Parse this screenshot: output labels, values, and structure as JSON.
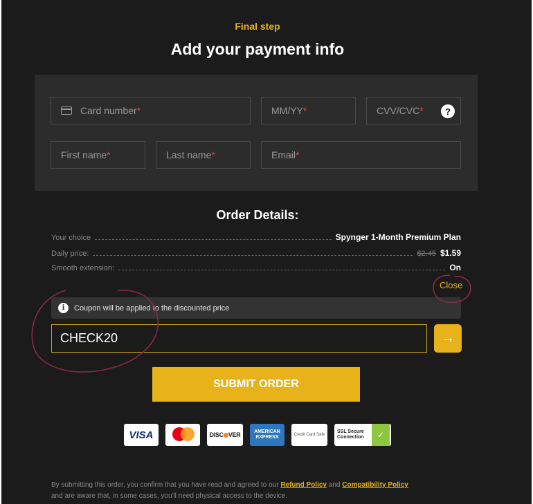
{
  "header": {
    "step_label": "Final step",
    "title": "Add your payment info"
  },
  "payment_form": {
    "card_number": {
      "placeholder": "Card number",
      "required_mark": "*",
      "icon": "credit-card-icon"
    },
    "expiry": {
      "placeholder": "MM/YY",
      "required_mark": "*"
    },
    "cvv": {
      "placeholder": "CVV/CVC",
      "required_mark": "*",
      "help": "?"
    },
    "first_name": {
      "placeholder": "First name",
      "required_mark": "*"
    },
    "last_name": {
      "placeholder": "Last name",
      "required_mark": "*"
    },
    "email": {
      "placeholder": "Email",
      "required_mark": "*"
    }
  },
  "order": {
    "title": "Order Details:",
    "rows": [
      {
        "label": "Your choice",
        "value": "Spynger 1-Month Premium Plan"
      },
      {
        "label": "Daily price:",
        "old_value": "$2.45",
        "value": "$1.59"
      },
      {
        "label": "Smooth extension:",
        "value": "On"
      }
    ],
    "close_label": "Close"
  },
  "coupon": {
    "notice": "Coupon will be applied to the discounted price",
    "info_icon": "i",
    "value": "CHECK20",
    "apply_icon": "→"
  },
  "submit_label": "SUBMIT ORDER",
  "badges": {
    "visa": "VISA",
    "mastercard": "mastercard",
    "discover": "DISCOVER",
    "amex": "AMERICAN EXPRESS",
    "safe": "Credit Card Safe",
    "ssl": "SSL Secure Connection"
  },
  "footer": {
    "text_1": "By submitting this order, you confirm that you have read and agreed to our ",
    "refund_link": "Refund Policy",
    "text_2": " and ",
    "compat_link": "Compatibility Policy",
    "text_3": "and are aware that, in some cases, you'll need physical access to the device."
  },
  "colors": {
    "background": "#1b1b1b",
    "panel": "#2c2c2c",
    "accent": "#e8b31a",
    "required": "#e04a4a",
    "annotation": "#8a2a45"
  }
}
